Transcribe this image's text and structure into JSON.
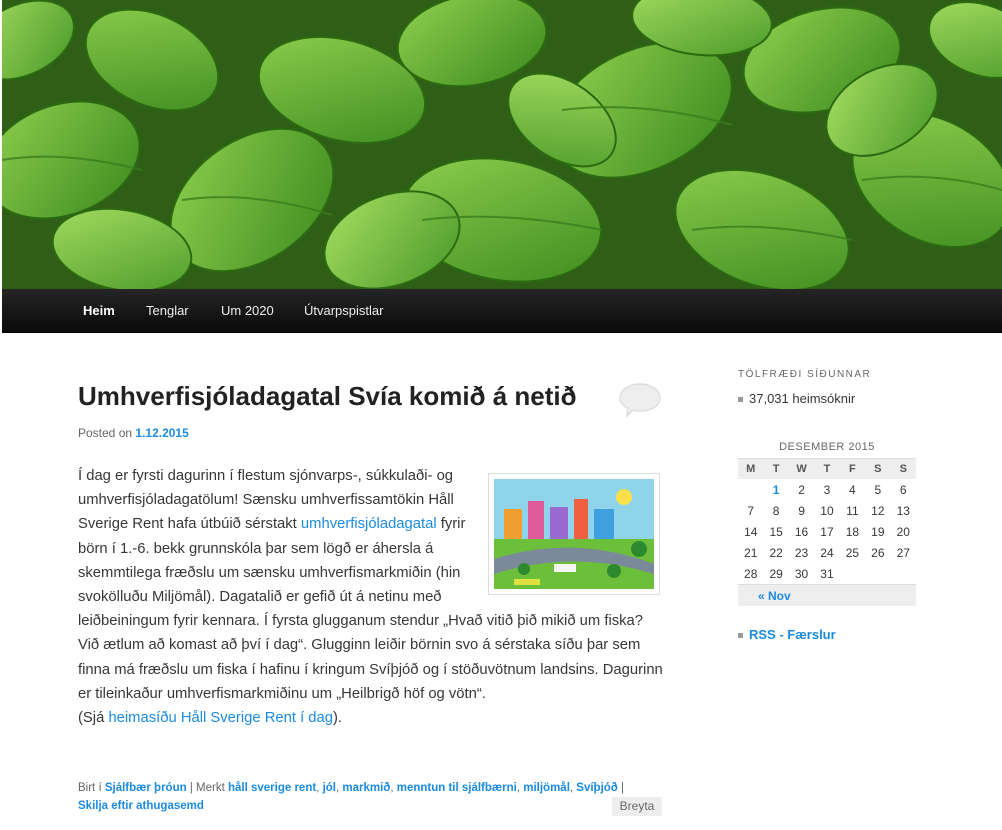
{
  "header": {
    "image": "green-leaves-header-image"
  },
  "nav": {
    "items": [
      {
        "label": "Heim",
        "active": true
      },
      {
        "label": "Tenglar",
        "active": false
      },
      {
        "label": "Um 2020",
        "active": false
      },
      {
        "label": "Útvarpspistlar",
        "active": false
      }
    ]
  },
  "post": {
    "title": "Umhverfisjóladagatal Svía komið á netið",
    "posted_prefix": "Posted on",
    "date": "1.12.2015",
    "body": {
      "p1_a": "Í dag er fyrsti dagurinn í flestum sjónvarps-, súkkulaði- og umhverfisjóladagatölum! Sænsku umhverfissamtökin Håll Sverige Rent hafa útbúið sérstakt ",
      "p1_link": "umhverfisjóladagatal",
      "p1_b": " fyrir börn í 1.-6. bekk grunnskóla þar sem lögð er áhersla á skemmtilega fræðslu um sænsku umhverfismarkmiðin (hin svokölluðu Miljömål). Dagatalið er gefið út á netinu með leiðbeiningum fyrir kennara. Í fyrsta glugganum stendur „Hvað vitið þið mikið um fiska? Við ætlum að komast að því í dag“. Glugginn leiðir börnin svo á sérstaka síðu þar sem finna má fræðslu um fiska í hafinu í kringum Svíþjóð og í stöðuvötnum landsins. Dagurinn er tileinkaður umhverfismarkmiðinu um „Heilbrigð höf og vötn“.",
      "p2_a": "(Sjá ",
      "p2_link": "heimasíðu Håll Sverige Rent í dag",
      "p2_b": ")."
    },
    "meta": {
      "cat_prefix": "Birt í",
      "category": "Sjálfbær þróun",
      "tag_prefix": "| Merkt",
      "tags": [
        "håll sverige rent",
        "jól",
        "markmið",
        "menntun til sjálfbærni",
        "miljömål",
        "Svíþjóð"
      ],
      "comment_link": "Skilja eftir athugasemd",
      "edit": "Breyta"
    }
  },
  "sidebar": {
    "stats_title": "TÖLFRÆÐI SÍÐUNNAR",
    "stats_value": "37,031 heimsóknir",
    "calendar": {
      "caption": "DESEMBER 2015",
      "weekdays": [
        "M",
        "T",
        "W",
        "T",
        "F",
        "S",
        "S"
      ],
      "weeks": [
        [
          "",
          "1",
          "2",
          "3",
          "4",
          "5",
          "6"
        ],
        [
          "7",
          "8",
          "9",
          "10",
          "11",
          "12",
          "13"
        ],
        [
          "14",
          "15",
          "16",
          "17",
          "18",
          "19",
          "20"
        ],
        [
          "21",
          "22",
          "23",
          "24",
          "25",
          "26",
          "27"
        ],
        [
          "28",
          "29",
          "30",
          "31",
          "",
          "",
          ""
        ]
      ],
      "linked_days": [
        "1"
      ],
      "prev_link": "« Nov"
    },
    "rss": "RSS - Færslur"
  },
  "colors": {
    "link": "#1b8be0",
    "nav_bg": "#1a1a1a",
    "leaf": "#5aa832"
  }
}
